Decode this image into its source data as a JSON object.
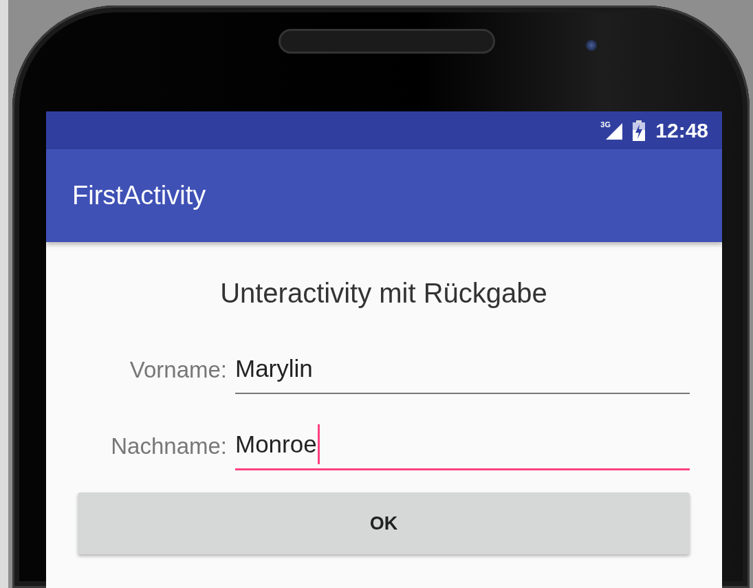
{
  "status_bar": {
    "network": "3G",
    "time": "12:48"
  },
  "app_bar": {
    "title": "FirstActivity"
  },
  "heading": "Unteractivity mit Rückgabe",
  "fields": [
    {
      "label": "Vorname:",
      "value": "Marylin",
      "focused": false
    },
    {
      "label": "Nachname:",
      "value": "Monroe",
      "focused": true
    }
  ],
  "button": {
    "label": "OK"
  }
}
